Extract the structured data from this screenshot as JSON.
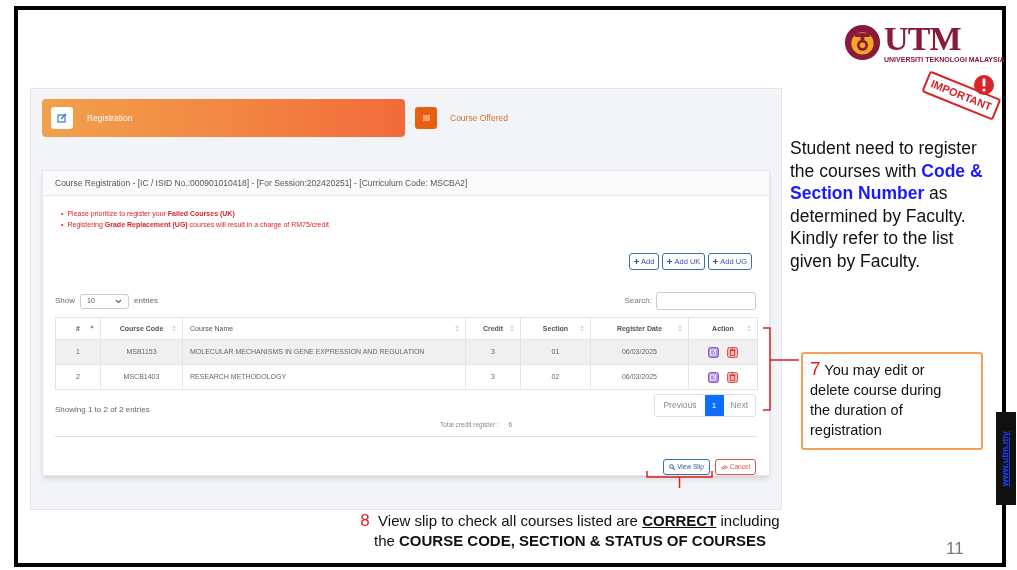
{
  "app": {
    "tabs": [
      {
        "label": "Registration",
        "selected": true
      },
      {
        "label": "Course Offered",
        "selected": false
      }
    ],
    "card": {
      "title": "Course Registration - [IC / ISID No.:000901010418] - [For Session:202420251] - [Curriculum Code: MSCBA2]",
      "notices": [
        {
          "bullet": "•",
          "text": "Please prioritize to register your **Failed Courses (UK)**"
        },
        {
          "bullet": "•",
          "text": "Registering **Grade Replacement (UG)** courses will result in a charge of RM75/credit"
        }
      ],
      "add_buttons": [
        "Add",
        "Add UK",
        "Add UG"
      ],
      "length": {
        "before": "Show",
        "value": "10",
        "after": "entries"
      },
      "search": {
        "label": "Search:"
      },
      "table": {
        "columns": [
          {
            "label": "#",
            "sorted": true
          },
          {
            "label": "Course Code",
            "sorted": false
          },
          {
            "label": "Course Name",
            "sorted": false
          },
          {
            "label": "Credit",
            "sorted": false
          },
          {
            "label": "Section",
            "sorted": false
          },
          {
            "label": "Register Date",
            "sorted": false
          },
          {
            "label": "Action",
            "sorted": false
          }
        ],
        "rows": [
          {
            "shaded": true,
            "cells": [
              "1",
              "MSB1153",
              "MOLECULAR MECHANISMS IN GENE EXPRESSION AND REGULATION",
              "3",
              "01",
              "06/03/2025"
            ]
          },
          {
            "shaded": false,
            "cells": [
              "2",
              "MSCB1403",
              "RESEARCH METHODOLOGY",
              "3",
              "02",
              "06/03/2025"
            ]
          }
        ]
      },
      "info": "Showing 1 to 2 of 2 entries",
      "pagination": {
        "previous": "Previous",
        "pages": [
          {
            "label": "1",
            "selected": true
          }
        ],
        "next": "Next"
      },
      "total": {
        "label": "Total credit register :",
        "value": "6"
      },
      "actions": [
        {
          "label": "View Slip",
          "kind": "primary"
        },
        {
          "label": "Cancel",
          "kind": "danger"
        }
      ]
    }
  },
  "slide": {
    "logo": {
      "name": "UTM",
      "subtitle": "UNIVERSITI TEKNOLOGI MALAYSIA"
    },
    "stamp": "IMPORTANT",
    "note": "Student need to register the courses with **Code & Section Number** as determined by Faculty. Kindly refer to the list given by Faculty.",
    "callout": {
      "number": "7",
      "text": "You may edit or delete course during the duration of registration"
    },
    "footer": {
      "number": "8",
      "line_1": "View slip to check all courses listed are **CORRECT** including",
      "line_2": "the **COURSE CODE, SECTION & STATUS OF COURSES**"
    },
    "website": "www.utm.my",
    "page_number": "11"
  }
}
